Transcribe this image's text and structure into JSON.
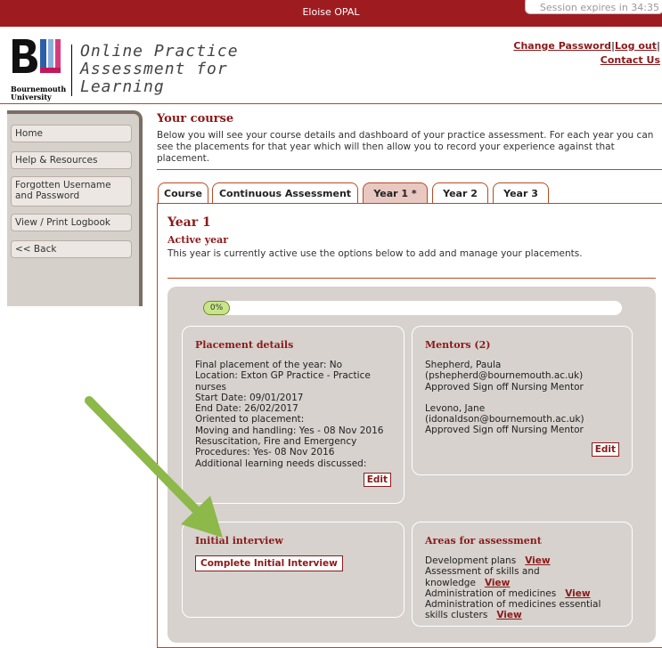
{
  "topbar": {
    "user": "Eloise OPAL",
    "session": "Session expires in 34:35"
  },
  "logo": {
    "university": [
      "Bournemouth",
      "University"
    ]
  },
  "app_title": [
    "Online Practice",
    "Assessment for",
    "Learning"
  ],
  "toplinks": {
    "change_password": "Change Password",
    "logout": "Log out",
    "contact": "Contact Us"
  },
  "sidebar": {
    "items": [
      {
        "label": "Home"
      },
      {
        "label": "Help & Resources"
      },
      {
        "label": "Forgotten Username and Password"
      },
      {
        "label": "View / Print Logbook"
      },
      {
        "label": "<< Back"
      }
    ]
  },
  "course": {
    "title": "Your course",
    "intro": "Below you will see your course details and dashboard of your practice assessment.  For each year you can see the placements for that year which will then allow you to record your experience against that placement."
  },
  "tabs": [
    {
      "label": "Course",
      "active": false
    },
    {
      "label": "Continuous Assessment",
      "active": false
    },
    {
      "label": "Year 1 *",
      "active": true
    },
    {
      "label": "Year 2",
      "active": false
    },
    {
      "label": "Year 3",
      "active": false
    }
  ],
  "year": {
    "title": "Year 1",
    "status": "Active year",
    "description": "This year is currently active use the options below to add and manage your placements."
  },
  "progress": {
    "percent": 0,
    "label": "0%"
  },
  "placement": {
    "title": "Placement details",
    "lines": [
      "Final placement of the year: No",
      "Location: Exton GP Practice - Practice nurses",
      "Start Date: 09/01/2017",
      "End Date: 26/02/2017",
      "Oriented to placement:",
      "Moving and handling: Yes - 08 Nov 2016",
      "Resuscitation, Fire and Emergency Procedures: Yes- 08 Nov 2016",
      "Additional learning needs discussed:"
    ],
    "edit": "Edit"
  },
  "mentors": {
    "title": "Mentors (2)",
    "list": [
      {
        "name": "Shepherd, Paula",
        "email": "(pshepherd@bournemouth.ac.uk)",
        "role": "Approved Sign off Nursing Mentor"
      },
      {
        "name": "Levono, Jane",
        "email": "(idonaldson@bournemouth.ac.uk)",
        "role": "Approved Sign off Nursing Mentor"
      }
    ],
    "edit": "Edit"
  },
  "interview": {
    "title": "Initial interview",
    "button": "Complete Initial Interview"
  },
  "areas": {
    "title": "Areas for assessment",
    "items": [
      {
        "label": "Development plans",
        "link": "View"
      },
      {
        "label": "Assessment of skills and knowledge",
        "link": "View"
      },
      {
        "label": "Administration of medicines",
        "link": "View"
      },
      {
        "label": "Administration of medicines essential skills clusters",
        "link": "View"
      }
    ]
  },
  "colors": {
    "brand": "#9e1c20",
    "accent": "#8b1a1a",
    "arrow": "#8db84a",
    "progress": "#c9e58a"
  }
}
